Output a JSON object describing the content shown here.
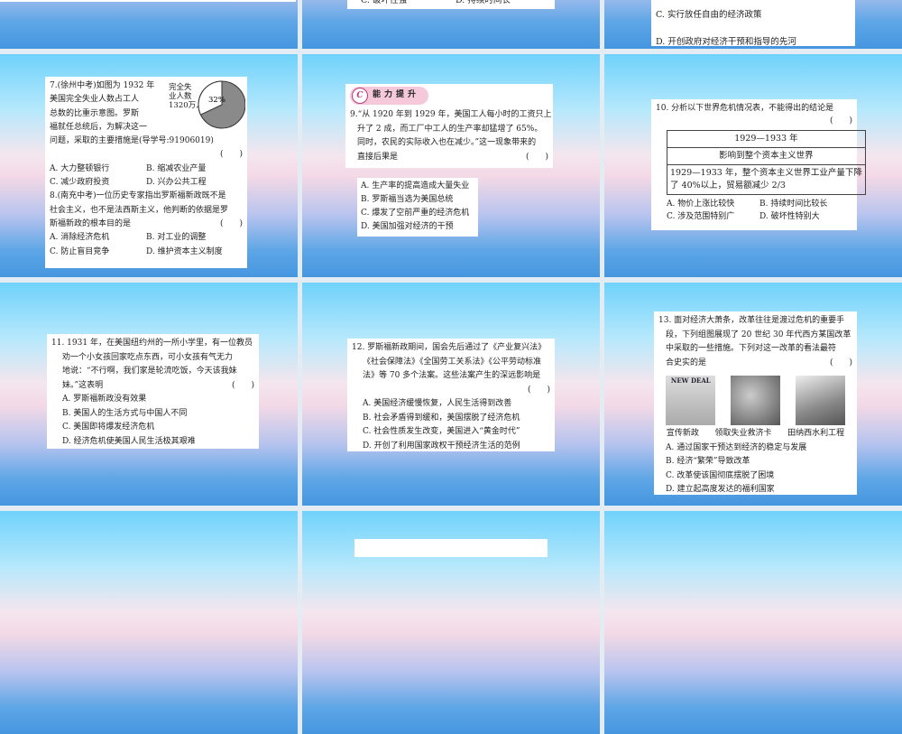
{
  "slide_prev": {
    "col2": {
      "opts": [
        "C. 破坏性强",
        "D. 持续时间长"
      ]
    },
    "col3": {
      "opts": [
        "C. 实行放任自由的经济政策",
        "D. 开创政府对经济干预和指导的先河"
      ]
    }
  },
  "q7": {
    "lines": [
      "7.(徐州中考)如图为 1932 年",
      "美国完全失业人数占工人",
      "总数的比重示意图。罗斯",
      "福就任总统后，为解决这一",
      "问题，采取的主要措施是(导学号:91906019)"
    ],
    "paren": "(　　)",
    "opts": [
      "A. 大力整顿银行",
      "B. 缩减农业产量",
      "C. 减少政府投资",
      "D. 兴办公共工程"
    ],
    "pie": {
      "legend": [
        "完全失",
        "业人数",
        "1320万人"
      ],
      "percent_label": "32%",
      "value": 32
    }
  },
  "q8": {
    "lines": [
      "8.(南充中考)一位历史专家指出罗斯福新政既不是",
      "社会主义，也不是法西斯主义，他判断的依据是罗",
      "斯福新政的根本目的是"
    ],
    "paren": "(　　)",
    "opts": [
      "A. 消除经济危机",
      "B. 对工业的调整",
      "C. 防止盲目竞争",
      "D. 维护资本主义制度"
    ]
  },
  "banner": {
    "letter": "C",
    "title": "能力提升"
  },
  "q9": {
    "lines": [
      "9.“从 1920 年到 1929 年，美国工人每小时的工资只上",
      "升了 2 成，而工厂中工人的生产率却猛增了 65%。",
      "同时，农民的实际收入也在减少。”这一现象带来的",
      "直接后果是"
    ],
    "paren": "(　　)",
    "opts": [
      "A. 生产率的提高造成大量失业",
      "B. 罗斯福当选为美国总统",
      "C. 爆发了空前严重的经济危机",
      "D. 美国加强对经济的干预"
    ]
  },
  "q10": {
    "line": "10. 分析以下世界危机情况表，不能得出的结论是",
    "paren": "(　　)",
    "table": [
      "1929—1933 年",
      "影响到整个资本主义世界",
      "1929—1933 年，整个资本主义世界工业产量下降",
      "了 40%以上，贸易额减少 2/3"
    ],
    "opts": [
      "A. 物价上涨比较快",
      "B. 持续时间比较长",
      "C. 涉及范围特别广",
      "D. 破坏性特别大"
    ]
  },
  "q11": {
    "lines": [
      "11. 1931 年，在美国纽约州的一所小学里，有一位教员",
      "劝一个小女孩回家吃点东西，可小女孩有气无力",
      "地说：“不行啊，我们家是轮流吃饭，今天该我妹",
      "妹。”这表明"
    ],
    "paren": "(　　)",
    "opts": [
      "A. 罗斯福新政没有效果",
      "B. 美国人的生活方式与中国人不同",
      "C. 美国即将爆发经济危机",
      "D. 经济危机使美国人民生活极其艰难"
    ]
  },
  "q12": {
    "lines": [
      "12. 罗斯福新政期间，国会先后通过了《产业复兴法》",
      "《社会保障法》《全国劳工关系法》《公平劳动标准",
      "法》等 70 多个法案。这些法案产生的深远影响是"
    ],
    "paren": "(　　)",
    "opts": [
      "A. 美国经济缓慢恢复，人民生活得到改善",
      "B. 社会矛盾得到缓和，美国摆脱了经济危机",
      "C. 社会性质发生改变，美国进入“黄金时代”",
      "D. 开创了利用国家政权干预经济生活的范例"
    ]
  },
  "q13": {
    "lines": [
      "13. 面对经济大萧条，改革往往是渡过危机的重要手",
      "段，下列组图展现了 20 世纪 30 年代西方某国改革",
      "中采取的一些措施。下列对这一改革的看法最符",
      "合史实的是"
    ],
    "paren": "(　　)",
    "poster_text": "NEW DEAL",
    "captions": [
      "宣传新政",
      "领取失业救济卡",
      "田纳西水利工程"
    ],
    "opts": [
      "A. 通过国家干预达到经济的稳定与发展",
      "B. 经济“繁荣”导致改革",
      "C. 改革使该国彻底摆脱了困境",
      "D. 建立起高度发达的福利国家"
    ]
  }
}
